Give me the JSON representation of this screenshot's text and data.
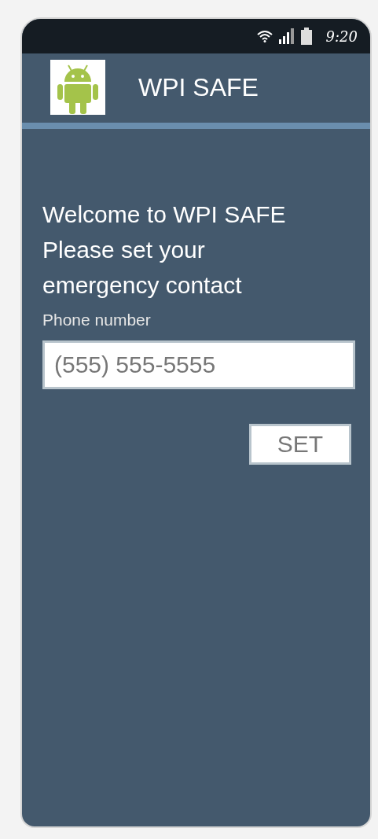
{
  "status_bar": {
    "time": "9:20"
  },
  "app_bar": {
    "title": "WPI SAFE"
  },
  "welcome": {
    "lines": [
      "Welcome to WPI SAFE",
      "Please set your",
      "emergency contact"
    ]
  },
  "phone_field": {
    "label": "Phone number",
    "placeholder": "(555) 555-5555"
  },
  "buttons": [
    "SET"
  ]
}
